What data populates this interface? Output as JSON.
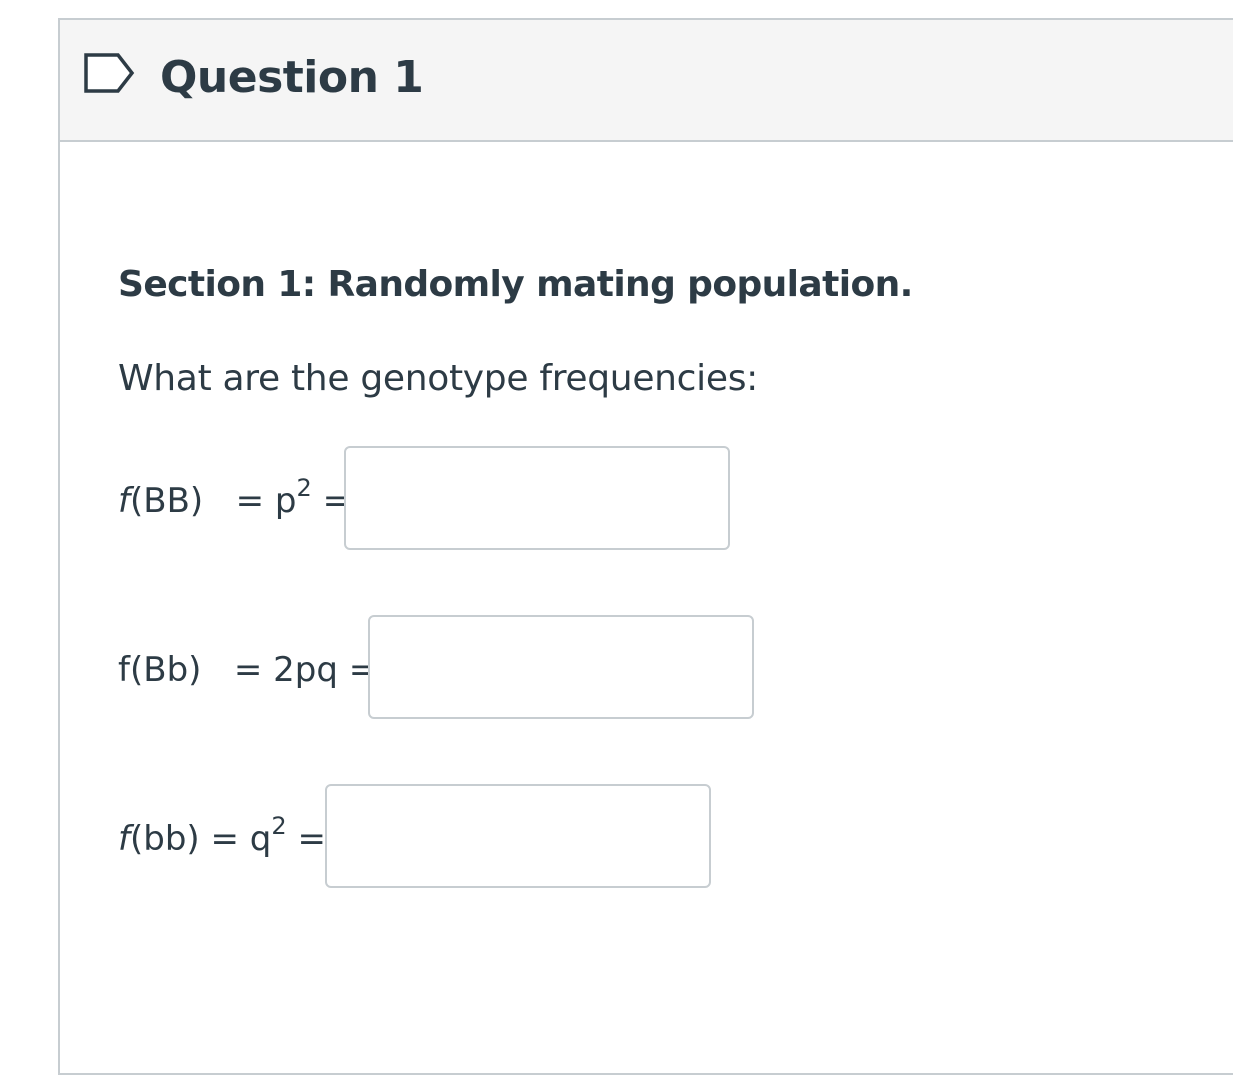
{
  "question": {
    "title": "Question 1",
    "flag_icon": "flag-outline-icon"
  },
  "body": {
    "section_title": "Section 1:  Randomly mating population.",
    "prompt": "What are the genotype frequencies:",
    "rows": [
      {
        "func": "f",
        "arg": "(BB)",
        "eq": " = p",
        "sup": "2",
        "tail": " =",
        "value": "",
        "placeholder": ""
      },
      {
        "func": "f",
        "arg": "(Bb)",
        "eq": " = 2pq",
        "sup": "",
        "tail": " =",
        "value": "",
        "placeholder": ""
      },
      {
        "func": "f",
        "arg": "(bb)",
        "eq": " = q",
        "sup": "2",
        "tail": " =",
        "value": "",
        "placeholder": ""
      }
    ]
  }
}
